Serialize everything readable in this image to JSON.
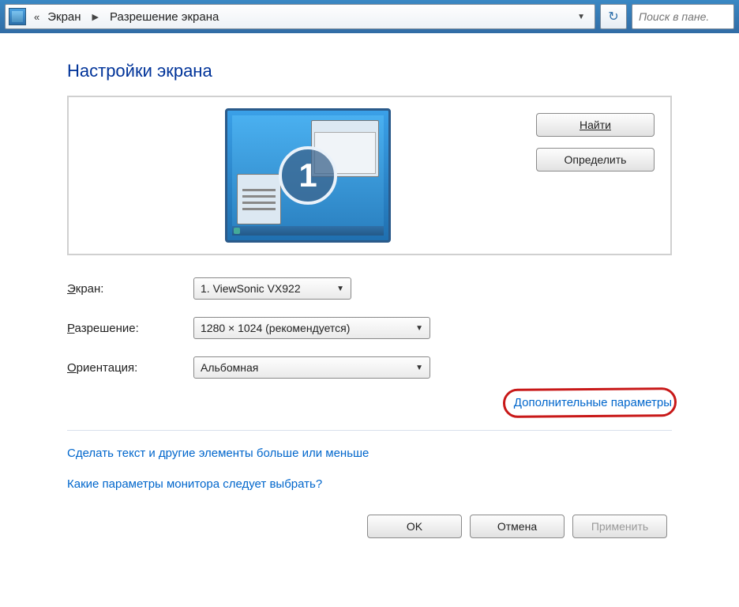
{
  "addressbar": {
    "crumb1": "Экран",
    "crumb2": "Разрешение экрана",
    "search_placeholder": "Поиск в пане."
  },
  "page": {
    "title": "Настройки экрана"
  },
  "preview": {
    "monitor_number": "1",
    "detect_label": "Найти",
    "identify_label": "Определить"
  },
  "form": {
    "display_label": "Экран:",
    "display_value": "1. ViewSonic VX922",
    "resolution_label": "Разрешение:",
    "resolution_value": "1280 × 1024 (рекомендуется)",
    "orientation_label": "Ориентация:",
    "orientation_value": "Альбомная"
  },
  "links": {
    "advanced": "Дополнительные параметры",
    "text_size": "Сделать текст и другие элементы больше или меньше",
    "which_settings": "Какие параметры монитора следует выбрать?"
  },
  "buttons": {
    "ok": "OK",
    "cancel": "Отмена",
    "apply": "Применить"
  }
}
